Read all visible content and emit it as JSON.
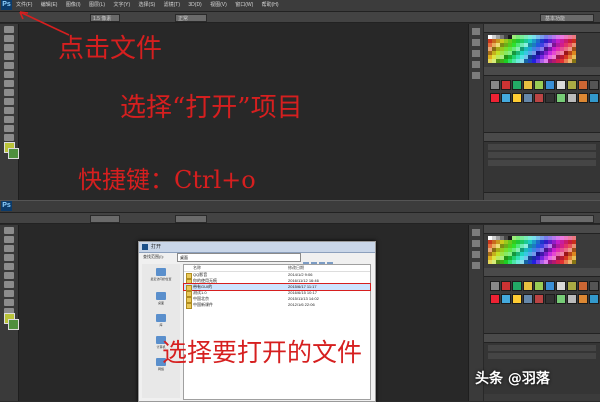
{
  "app": {
    "logo": "Ps"
  },
  "menu": {
    "items": [
      "文件(F)",
      "编辑(E)",
      "图像(I)",
      "图层(L)",
      "文字(Y)",
      "选择(S)",
      "滤镜(T)",
      "3D(D)",
      "视图(V)",
      "窗口(W)",
      "帮助(H)"
    ]
  },
  "options": {
    "size_value": "1.5 像素",
    "mode_value": "正常",
    "workspace": "基本功能"
  },
  "annotations": {
    "top_line1": "点击文件",
    "top_line2": "选择“打开”项目",
    "top_line3": "快捷键：Ctrl+o",
    "bottom_line1": "选择要打开的文件"
  },
  "dialog": {
    "title": "打开",
    "look_in_label": "查找范围(I):",
    "look_in_value": "桌面",
    "col_name": "名称",
    "col_date": "修改日期",
    "places": [
      "最近访问的位置",
      "桌面",
      "库",
      "计算机",
      "网络"
    ],
    "files": [
      {
        "name": "QQ影音",
        "date": "2014/1/2 9:06",
        "selected": false
      },
      {
        "name": "你的使用无痕",
        "date": "2016/11/12 16:46",
        "selected": false
      },
      {
        "name": "带有GUI的",
        "date": "2015/6/17 11:17",
        "selected": true
      },
      {
        "name": "测试1.0",
        "date": "2016/6/15 10:17",
        "selected": false
      },
      {
        "name": "中国北京",
        "date": "2015/11/13 14:02",
        "selected": false
      },
      {
        "name": "中国新课件",
        "date": "2012/1/6 22:06",
        "selected": false
      }
    ]
  },
  "watermark": "头条 @羽落",
  "colors": {
    "annotation": "#d61f1f",
    "panel_bg": "#282828"
  }
}
